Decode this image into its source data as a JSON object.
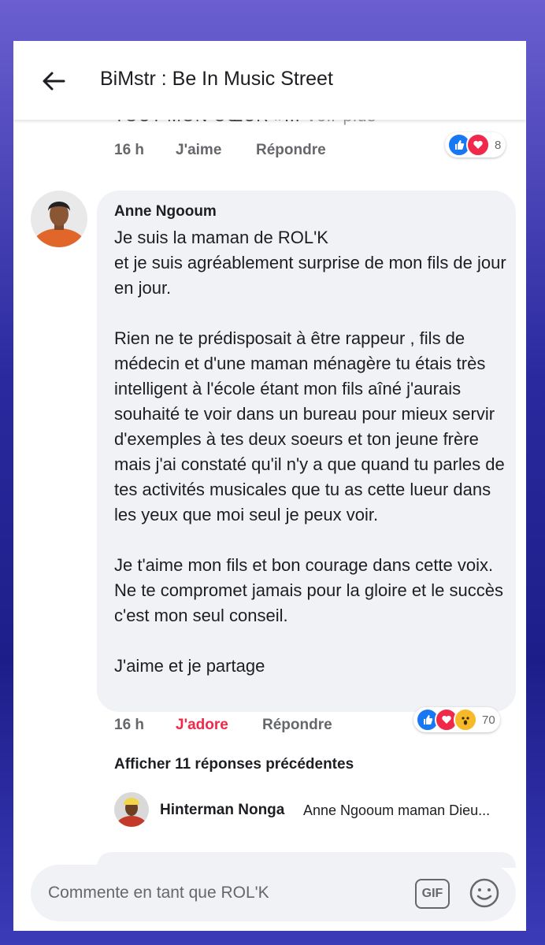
{
  "header": {
    "title": "BiMstr : Be In Music Street"
  },
  "prev_comment": {
    "clipped_text": "TOUT MON CŒUR »...",
    "see_more": "Voir plus",
    "time": "16 h",
    "like_label": "J'aime",
    "reply_label": "Répondre",
    "reaction_count": "8",
    "reactions": [
      "like-icon",
      "love-icon"
    ]
  },
  "comment": {
    "author": "Anne Ngooum",
    "paragraphs": [
      "Je suis la maman de ROL'K\net je suis agréablement surprise de mon fils de jour en jour.",
      "Rien ne te prédisposait à être rappeur , fils de médecin et d'une maman ménagère tu étais très intelligent à l'école étant mon fils aîné j'aurais souhaité te voir dans un bureau pour mieux servir d'exemples à tes deux soeurs et ton jeune frère mais j'ai constaté qu'il n'y a que quand tu parles de tes activités musicales que tu as cette lueur dans les yeux que moi seul je peux voir.",
      "Je t'aime mon fils et bon courage dans cette voix. Ne te compromet jamais pour la gloire et le succès c'est mon seul conseil.",
      "J'aime et je partage"
    ],
    "time": "16 h",
    "react_label": "J'adore",
    "reply_label": "Répondre",
    "reaction_count": "70",
    "reactions": [
      "like-icon",
      "love-icon",
      "wow-icon"
    ],
    "react_color": "#f02849"
  },
  "replies": {
    "show_previous": "Afficher 11 réponses précédentes",
    "latest": {
      "author": "Hinterman Nonga",
      "text": "Anne Ngooum maman Dieu..."
    }
  },
  "composer": {
    "placeholder": "Commente en tant que ROL'K",
    "gif_label": "GIF"
  },
  "colors": {
    "like": "#1877f2",
    "love": "#f02849",
    "wow": "#f7b928",
    "bubble": "#f0f2f5"
  }
}
